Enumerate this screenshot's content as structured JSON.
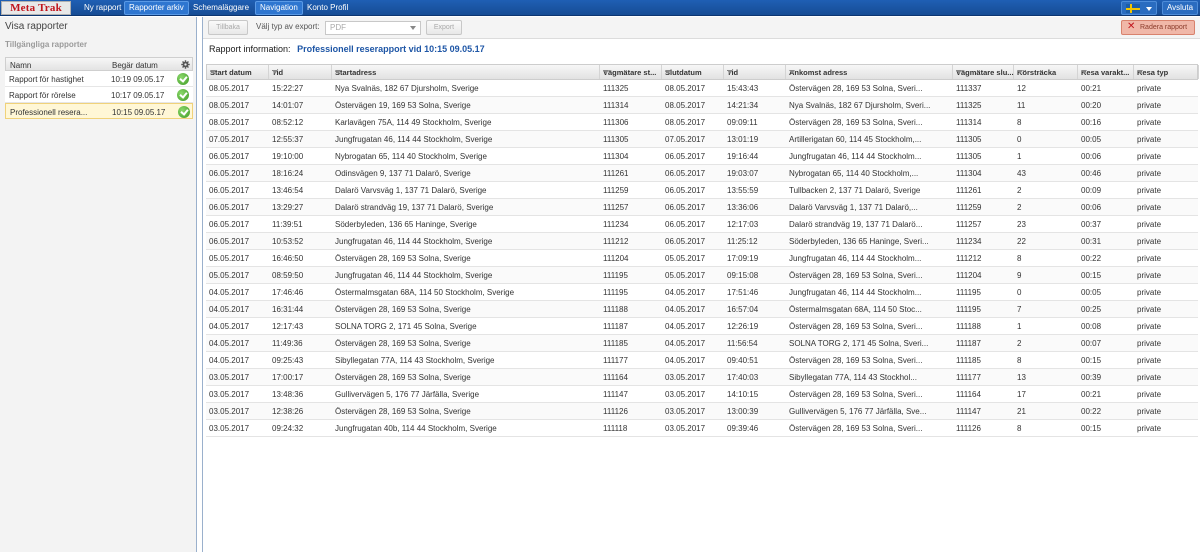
{
  "app": {
    "logo": "Meta Trak",
    "nav": [
      "Ny rapport",
      "Rapporter arkiv",
      "Schemaläggare",
      "Navigation",
      "Konto Profil"
    ],
    "logout": "Avsluta",
    "language_flag": "swedish-flag-icon"
  },
  "left": {
    "title": "Visa rapporter",
    "subtitle": "Tillgängliga rapporter",
    "headers": {
      "name": "Namn",
      "date": "Begär datum"
    },
    "reports": [
      {
        "name": "Rapport för hastighet",
        "date": "10:19 09.05.17",
        "status": "ok"
      },
      {
        "name": "Rapport för rörelse",
        "date": "10:17 09.05.17",
        "status": "ok"
      },
      {
        "name": "Professionell resera...",
        "date": "10:15 09.05.17",
        "status": "ok"
      }
    ],
    "selected_index": 2
  },
  "toolbar": {
    "back": "Tillbaka",
    "export_label": "Välj typ av export:",
    "export_value": "PDF",
    "export_button": "Export",
    "delete_button": "Radera rapport"
  },
  "info": {
    "label": "Rapport information:",
    "value": "Professionell reserapport vid 10:15 09.05.17"
  },
  "table": {
    "columns": [
      "Start datum",
      "Tid",
      "Startadress",
      "Vägmätare st...",
      "Slutdatum",
      "Tid",
      "Ankomst adress",
      "Vägmätare slu...",
      "Körsträcka",
      "Resa varakt...",
      "Resa typ"
    ],
    "rows": [
      [
        "08.05.2017",
        "15:22:27",
        "Nya Svalnäs, 182 67 Djursholm, Sverige",
        "111325",
        "08.05.2017",
        "15:43:43",
        "Östervägen 28, 169 53 Solna, Sveri...",
        "111337",
        "12",
        "00:21",
        "private"
      ],
      [
        "08.05.2017",
        "14:01:07",
        "Östervägen 19, 169 53 Solna, Sverige",
        "111314",
        "08.05.2017",
        "14:21:34",
        "Nya Svalnäs, 182 67 Djursholm, Sveri...",
        "111325",
        "11",
        "00:20",
        "private"
      ],
      [
        "08.05.2017",
        "08:52:12",
        "Karlavägen 75A, 114 49 Stockholm, Sverige",
        "111306",
        "08.05.2017",
        "09:09:11",
        "Östervägen 28, 169 53 Solna, Sveri...",
        "111314",
        "8",
        "00:16",
        "private"
      ],
      [
        "07.05.2017",
        "12:55:37",
        "Jungfrugatan 46, 114 44 Stockholm, Sverige",
        "111305",
        "07.05.2017",
        "13:01:19",
        "Artillerigatan 60, 114 45 Stockholm,...",
        "111305",
        "0",
        "00:05",
        "private"
      ],
      [
        "06.05.2017",
        "19:10:00",
        "Nybrogatan 65, 114 40 Stockholm, Sverige",
        "111304",
        "06.05.2017",
        "19:16:44",
        "Jungfrugatan 46, 114 44 Stockholm...",
        "111305",
        "1",
        "00:06",
        "private"
      ],
      [
        "06.05.2017",
        "18:16:24",
        "Odinsvägen 9, 137 71 Dalarö, Sverige",
        "111261",
        "06.05.2017",
        "19:03:07",
        "Nybrogatan 65, 114 40 Stockholm,...",
        "111304",
        "43",
        "00:46",
        "private"
      ],
      [
        "06.05.2017",
        "13:46:54",
        "Dalarö Varvsväg 1, 137 71 Dalarö, Sverige",
        "111259",
        "06.05.2017",
        "13:55:59",
        "Tullbacken 2, 137 71 Dalarö, Sverige",
        "111261",
        "2",
        "00:09",
        "private"
      ],
      [
        "06.05.2017",
        "13:29:27",
        "Dalarö strandväg 19, 137 71 Dalarö, Sverige",
        "111257",
        "06.05.2017",
        "13:36:06",
        "Dalarö Varvsväg 1, 137 71 Dalarö,...",
        "111259",
        "2",
        "00:06",
        "private"
      ],
      [
        "06.05.2017",
        "11:39:51",
        "Söderbyleden, 136 65 Haninge, Sverige",
        "111234",
        "06.05.2017",
        "12:17:03",
        "Dalarö strandväg 19, 137 71 Dalarö...",
        "111257",
        "23",
        "00:37",
        "private"
      ],
      [
        "06.05.2017",
        "10:53:52",
        "Jungfrugatan 46, 114 44 Stockholm, Sverige",
        "111212",
        "06.05.2017",
        "11:25:12",
        "Söderbyleden, 136 65 Haninge, Sveri...",
        "111234",
        "22",
        "00:31",
        "private"
      ],
      [
        "05.05.2017",
        "16:46:50",
        "Östervägen 28, 169 53 Solna, Sverige",
        "111204",
        "05.05.2017",
        "17:09:19",
        "Jungfrugatan 46, 114 44 Stockholm...",
        "111212",
        "8",
        "00:22",
        "private"
      ],
      [
        "05.05.2017",
        "08:59:50",
        "Jungfrugatan 46, 114 44 Stockholm, Sverige",
        "111195",
        "05.05.2017",
        "09:15:08",
        "Östervägen 28, 169 53 Solna, Sveri...",
        "111204",
        "9",
        "00:15",
        "private"
      ],
      [
        "04.05.2017",
        "17:46:46",
        "Östermalmsgatan 68A, 114 50 Stockholm, Sverige",
        "111195",
        "04.05.2017",
        "17:51:46",
        "Jungfrugatan 46, 114 44 Stockholm...",
        "111195",
        "0",
        "00:05",
        "private"
      ],
      [
        "04.05.2017",
        "16:31:44",
        "Östervägen 28, 169 53 Solna, Sverige",
        "111188",
        "04.05.2017",
        "16:57:04",
        "Östermalmsgatan 68A, 114 50 Stoc...",
        "111195",
        "7",
        "00:25",
        "private"
      ],
      [
        "04.05.2017",
        "12:17:43",
        "SOLNA TORG 2, 171 45 Solna, Sverige",
        "111187",
        "04.05.2017",
        "12:26:19",
        "Östervägen 28, 169 53 Solna, Sveri...",
        "111188",
        "1",
        "00:08",
        "private"
      ],
      [
        "04.05.2017",
        "11:49:36",
        "Östervägen 28, 169 53 Solna, Sverige",
        "111185",
        "04.05.2017",
        "11:56:54",
        "SOLNA TORG 2, 171 45 Solna, Sveri...",
        "111187",
        "2",
        "00:07",
        "private"
      ],
      [
        "04.05.2017",
        "09:25:43",
        "Sibyllegatan 77A, 114 43 Stockholm, Sverige",
        "111177",
        "04.05.2017",
        "09:40:51",
        "Östervägen 28, 169 53 Solna, Sveri...",
        "111185",
        "8",
        "00:15",
        "private"
      ],
      [
        "03.05.2017",
        "17:00:17",
        "Östervägen 28, 169 53 Solna, Sverige",
        "111164",
        "03.05.2017",
        "17:40:03",
        "Sibyllegatan 77A, 114 43 Stockhol...",
        "111177",
        "13",
        "00:39",
        "private"
      ],
      [
        "03.05.2017",
        "13:48:36",
        "Gullivervägen 5, 176 77 Järfälla, Sverige",
        "111147",
        "03.05.2017",
        "14:10:15",
        "Östervägen 28, 169 53 Solna, Sveri...",
        "111164",
        "17",
        "00:21",
        "private"
      ],
      [
        "03.05.2017",
        "12:38:26",
        "Östervägen 28, 169 53 Solna, Sverige",
        "111126",
        "03.05.2017",
        "13:00:39",
        "Gullivervägen 5, 176 77 Järfälla, Sve...",
        "111147",
        "21",
        "00:22",
        "private"
      ],
      [
        "03.05.2017",
        "09:24:32",
        "Jungfrugatan 40b, 114 44 Stockholm, Sverige",
        "111118",
        "03.05.2017",
        "09:39:46",
        "Östervägen 28, 169 53 Solna, Sveri...",
        "111126",
        "8",
        "00:15",
        "private"
      ]
    ]
  },
  "colors": {
    "topbar": "#1f5fb4",
    "logo_text": "#c0141c",
    "info_value": "#1e56a6",
    "selected_row": "#fff7d6",
    "status_ok": "#3f9a25",
    "delete_button": "#f0b7a8"
  }
}
